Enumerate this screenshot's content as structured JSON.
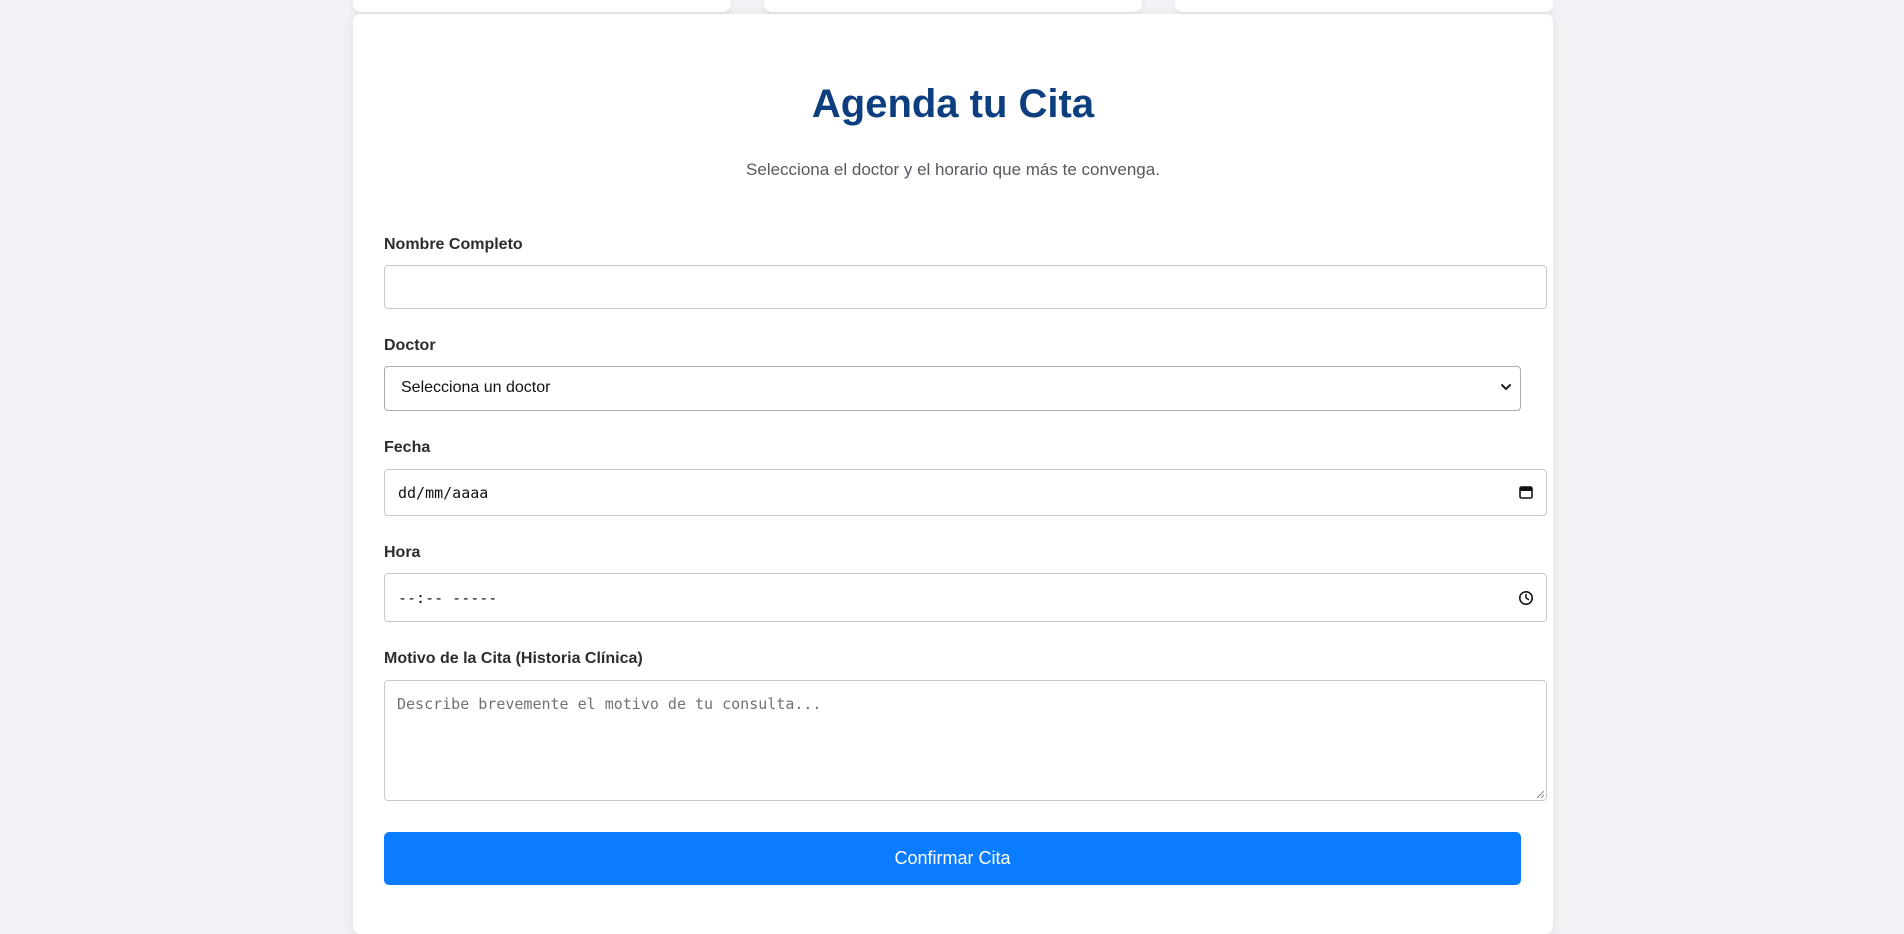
{
  "header": {
    "title": "Agenda tu Cita",
    "subtitle": "Selecciona el doctor y el horario que más te convenga."
  },
  "form": {
    "name": {
      "label": "Nombre Completo",
      "value": ""
    },
    "doctor": {
      "label": "Doctor",
      "selected": "Selecciona un doctor"
    },
    "date": {
      "label": "Fecha",
      "value": "dd/mm/aaaa"
    },
    "time": {
      "label": "Hora",
      "value": "--:-- -----"
    },
    "reason": {
      "label": "Motivo de la Cita (Historia Clínica)",
      "placeholder": "Describe brevemente el motivo de tu consulta..."
    },
    "submit_label": "Confirmar Cita"
  },
  "icons": {
    "select": "chevron-down-icon",
    "date": "calendar-icon",
    "time": "clock-icon"
  },
  "colors": {
    "background": "#f0f2f5",
    "title": "#0d3f80",
    "primary_button": "#0a7cff"
  }
}
